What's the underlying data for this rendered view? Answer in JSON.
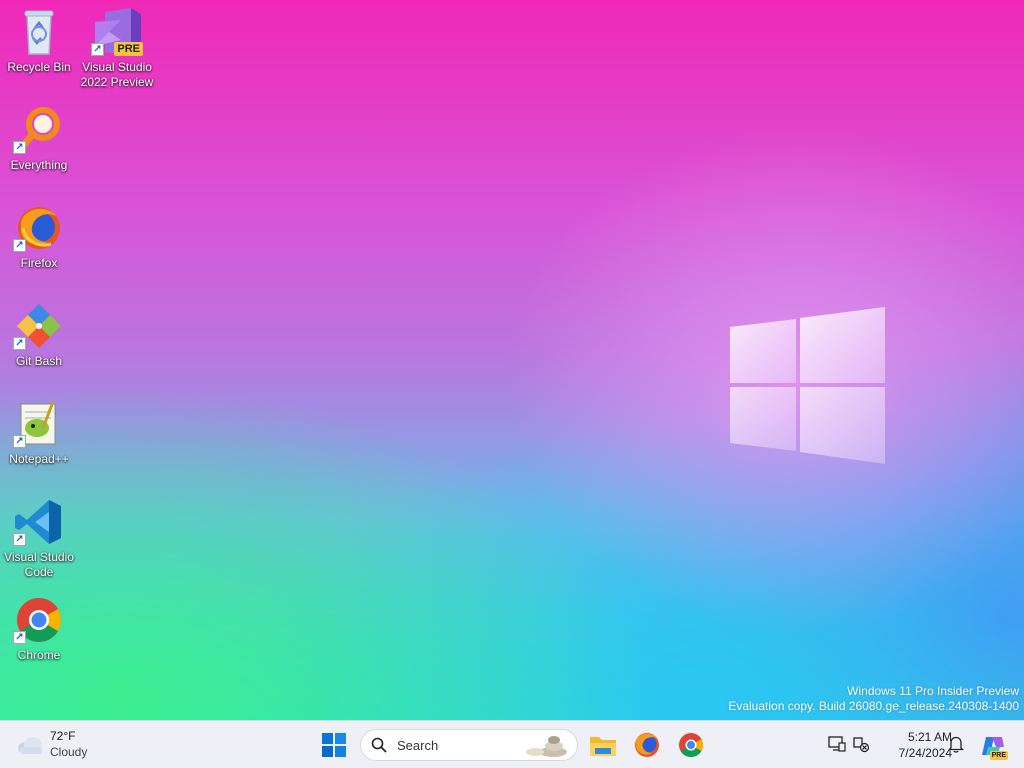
{
  "desktop": {
    "icons": [
      {
        "label": "Recycle Bin"
      },
      {
        "label": "Visual Studio\n2022 Preview",
        "badge": "PRE"
      },
      {
        "label": "Everything"
      },
      {
        "label": "Firefox"
      },
      {
        "label": "Git Bash"
      },
      {
        "label": "Notepad++"
      },
      {
        "label": "Visual Studio\nCode"
      },
      {
        "label": "Chrome"
      }
    ],
    "watermark": {
      "line1": "Windows 11 Pro Insider Preview",
      "line2": "Evaluation copy. Build 26080.ge_release.240308-1400"
    }
  },
  "taskbar": {
    "weather": {
      "temp": "72°F",
      "condition": "Cloudy",
      "icon": "cloud-icon"
    },
    "start": {
      "icon": "windows-start-icon"
    },
    "search": {
      "label": "Search",
      "icon": "search-icon"
    },
    "apps": [
      {
        "name": "File Explorer",
        "icon": "folder-icon"
      },
      {
        "name": "Firefox",
        "icon": "firefox-icon"
      },
      {
        "name": "Chrome",
        "icon": "chrome-icon"
      }
    ],
    "tray": {
      "time": "5:21 AM",
      "date": "7/24/2024",
      "copilot_badge": "PRE"
    }
  },
  "colors": {
    "accent": "#0067c0",
    "taskbar_bg": "#eef0f5"
  }
}
